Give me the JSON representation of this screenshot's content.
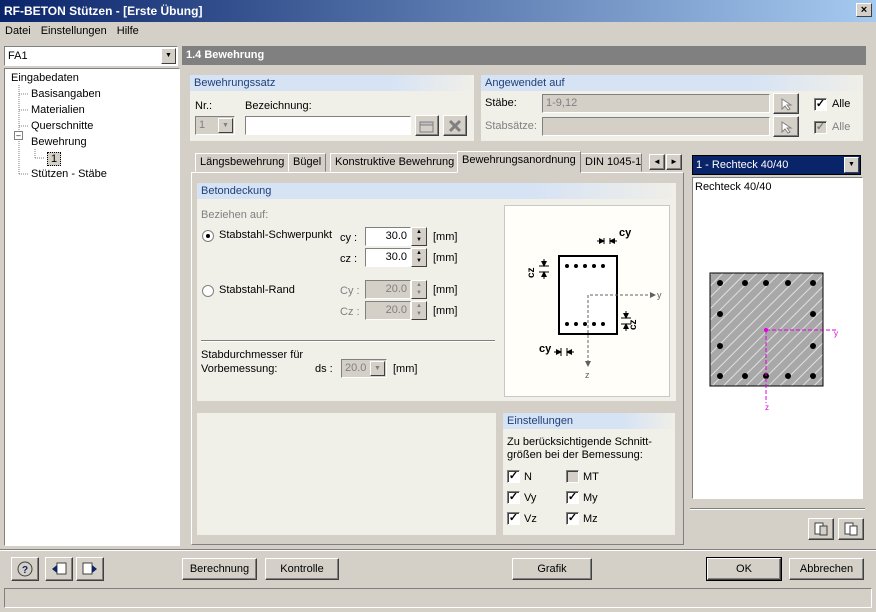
{
  "window": {
    "title": "RF-BETON Stützen - [Erste Übung]",
    "close_glyph": "×"
  },
  "menu": [
    "Datei",
    "Einstellungen",
    "Hilfe"
  ],
  "case_select": {
    "value": "FA1"
  },
  "tree": {
    "root": "Eingabedaten",
    "items": [
      "Basisangaben",
      "Materialien",
      "Querschnitte",
      "Bewehrung",
      "1",
      "Stützen - Stäbe"
    ],
    "collapse_glyph": "–"
  },
  "section_title": "1.4 Bewehrung",
  "bewehrungssatz": {
    "title": "Bewehrungssatz",
    "nr_label": "Nr.:",
    "nr_value": "1",
    "bez_label": "Bezeichnung:",
    "bez_value": ""
  },
  "angewendet": {
    "title": "Angewendet auf",
    "staebe_label": "Stäbe:",
    "staebe_value": "1-9,12",
    "stabsaetze_label": "Stabsätze:",
    "stabsaetze_value": "",
    "alle1": "Alle",
    "alle2": "Alle"
  },
  "tabs": [
    "Längsbewehrung",
    "Bügel",
    "Konstruktive Bewehrung",
    "Bewehrungsanordnung",
    "DIN 1045-1"
  ],
  "tab_nav": {
    "prev": "◄",
    "next": "►"
  },
  "betondeckung": {
    "title": "Betondeckung",
    "beziehen_label": "Beziehen auf:",
    "opt1": "Stabstahl-Schwerpunkt",
    "opt2": "Stabstahl-Rand",
    "cy_label": "cy :",
    "cz_label": "cz :",
    "cy_value": "30.0",
    "cz_value": "30.0",
    "cy2_label": "Cy :",
    "cz2_label": "Cz :",
    "cy2_value": "20.0",
    "cz2_value": "20.0",
    "unit": "[mm]",
    "stabd_label1": "Stabdurchmesser für",
    "stabd_label2": "Vorbemessung:",
    "ds_label": "ds :",
    "ds_value": "20.0",
    "ds_unit": "[mm]"
  },
  "diagram_labels": {
    "cy_top": "cy",
    "cz_left": "cz",
    "cz_right": "cz",
    "cy_bottom": "cy",
    "y_axis": "y",
    "z_axis": "z"
  },
  "einstellungen": {
    "title": "Einstellungen",
    "desc1": "Zu berücksichtigende Schnitt-",
    "desc2": "größen bei der Bemessung:",
    "items": [
      {
        "label": "N",
        "checked": true,
        "disabled": false
      },
      {
        "label": "MT",
        "checked": false,
        "disabled": true
      },
      {
        "label": "Vy",
        "checked": true,
        "disabled": false
      },
      {
        "label": "My",
        "checked": true,
        "disabled": false
      },
      {
        "label": "Vz",
        "checked": true,
        "disabled": false
      },
      {
        "label": "Mz",
        "checked": true,
        "disabled": false
      }
    ]
  },
  "cross_section": {
    "select": "1 - Rechteck 40/40",
    "caption": "Rechteck 40/40",
    "y_label": "y",
    "z_label": "z",
    "axis_color": "#e000e0"
  },
  "buttons": {
    "berechnung": "Berechnung",
    "kontrolle": "Kontrolle",
    "grafik": "Grafik",
    "ok": "OK",
    "abbrechen": "Abbrechen"
  },
  "icons": [
    "help-icon",
    "previous-icon",
    "next-icon",
    "pick-icon",
    "delete-icon",
    "new-icon",
    "info-icon",
    "export-icon"
  ],
  "check_glyph": "✓",
  "combo_arrow_glyph": "▼"
}
